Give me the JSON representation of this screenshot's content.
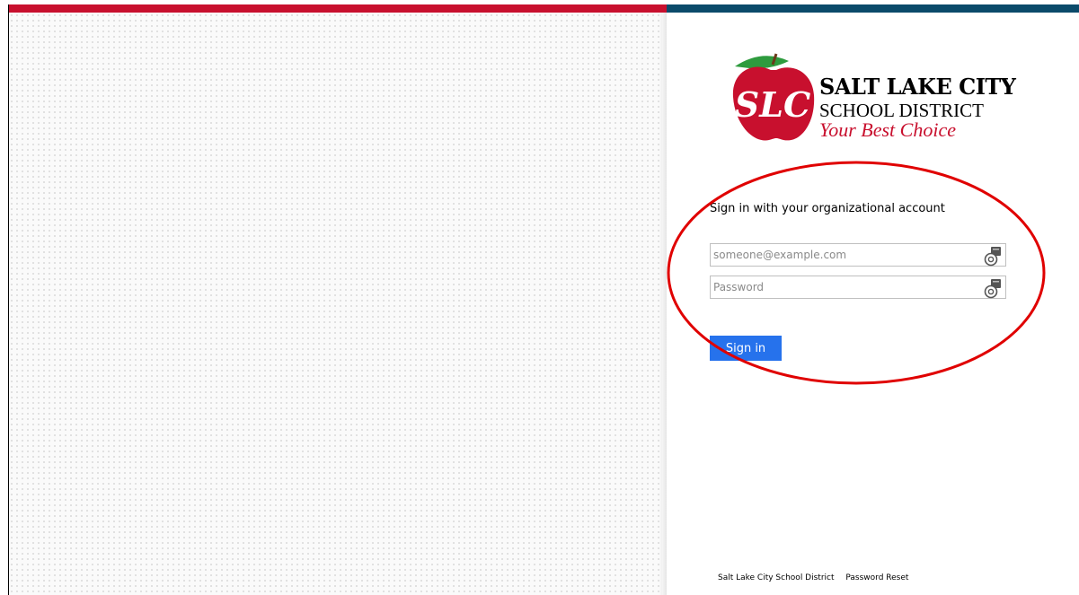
{
  "logo": {
    "line1": "SALT LAKE CITY",
    "line2": "SCHOOL DISTRICT",
    "line3": "Your Best Choice",
    "monogram": "SLC",
    "brand_red": "#c8102e",
    "leaf_green": "#2e9b3e"
  },
  "form": {
    "heading": "Sign in with your organizational account",
    "email_placeholder": "someone@example.com",
    "password_placeholder": "Password",
    "signin_label": "Sign in",
    "field_icon": "password-manager-key-icon"
  },
  "footer": {
    "link1": "Salt Lake City School District",
    "link2": "Password Reset"
  },
  "colors": {
    "accent_bar_left": "#c8102e",
    "accent_bar_right": "#0b4a6a",
    "signin_button": "#2672ec",
    "annotation_circle": "#e00000"
  }
}
